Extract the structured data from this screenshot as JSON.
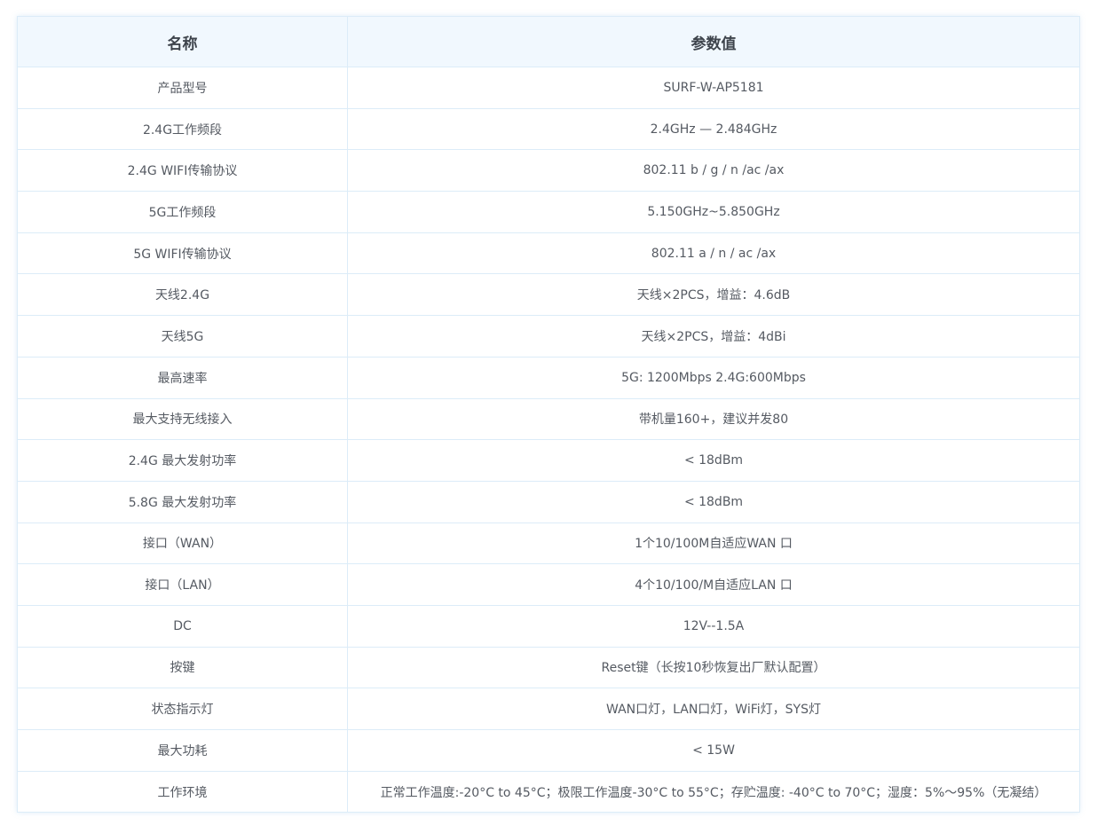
{
  "table": {
    "headers": {
      "name": "名称",
      "value": "参数值"
    },
    "rows": [
      {
        "name": "产品型号",
        "value": "SURF-W-AP5181"
      },
      {
        "name": "2.4G工作频段",
        "value": "2.4GHz — 2.484GHz"
      },
      {
        "name": "2.4G WIFI传输协议",
        "value": "802.11 b / g / n /ac /ax"
      },
      {
        "name": "5G工作频段",
        "value": "5.150GHz~5.850GHz"
      },
      {
        "name": "5G WIFI传输协议",
        "value": "802.11 a / n / ac /ax"
      },
      {
        "name": "天线2.4G",
        "value": "天线×2PCS，增益：4.6dB"
      },
      {
        "name": "天线5G",
        "value": "天线×2PCS，增益：4dBi"
      },
      {
        "name": "最高速率",
        "value": "5G: 1200Mbps   2.4G:600Mbps"
      },
      {
        "name": "最大支持无线接入",
        "value": "带机量160+，建议并发80"
      },
      {
        "name": "2.4G 最大发射功率",
        "value": "< 18dBm"
      },
      {
        "name": "5.8G 最大发射功率",
        "value": "< 18dBm"
      },
      {
        "name": "接口（WAN）",
        "value": "1个10/100M自适应WAN 口"
      },
      {
        "name": "接口（LAN）",
        "value": "4个10/100/M自适应LAN 口"
      },
      {
        "name": "DC",
        "value": "12V--1.5A"
      },
      {
        "name": "按键",
        "value": "Reset键（长按10秒恢复出厂默认配置）"
      },
      {
        "name": "状态指示灯",
        "value": "WAN口灯，LAN口灯，WiFi灯，SYS灯"
      },
      {
        "name": "最大功耗",
        "value": "< 15W"
      },
      {
        "name": "工作环境",
        "value": "正常工作温度:-20°C to 45°C；极限工作温度-30°C to 55°C；存贮温度: -40°C to 70°C；湿度：5%～95%（无凝结）"
      }
    ]
  },
  "colors": {
    "header_bg": "#f1f8fe",
    "border": "#dcecf8",
    "text": "#555a62"
  }
}
